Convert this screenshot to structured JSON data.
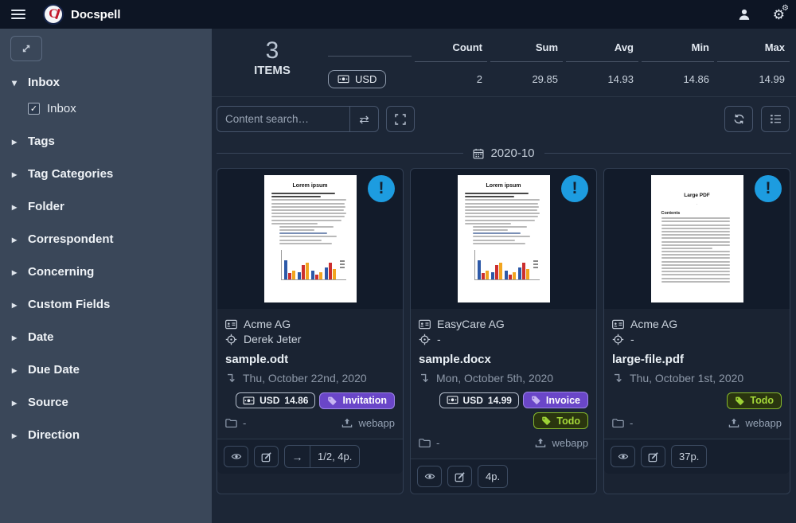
{
  "navbar": {
    "title": "Docspell"
  },
  "sidebar": {
    "inbox_header": "Inbox",
    "inbox_filter_label": "Inbox",
    "inbox_checked": true,
    "items": [
      "Tags",
      "Tag Categories",
      "Folder",
      "Correspondent",
      "Concerning",
      "Custom Fields",
      "Date",
      "Due Date",
      "Source",
      "Direction"
    ]
  },
  "stats": {
    "count_value": "3",
    "count_label": "ITEMS",
    "currency": "USD",
    "columns": [
      "Count",
      "Sum",
      "Avg",
      "Min",
      "Max"
    ],
    "values": [
      "2",
      "29.85",
      "14.93",
      "14.86",
      "14.99"
    ]
  },
  "toolbar": {
    "search_placeholder": "Content search…"
  },
  "group": {
    "label": "2020-10"
  },
  "cards": [
    {
      "correspondent": "Acme AG",
      "concerning": "Derek Jeter",
      "filename": "sample.odt",
      "date": "Thu, October 22nd, 2020",
      "money_currency": "USD",
      "money_amount": "14.86",
      "tags": [
        {
          "label": "Invitation",
          "color": "purple"
        }
      ],
      "folder": "-",
      "source": "webapp",
      "pages": "1/2, 4p.",
      "has_nav_arrow": true,
      "thumb": {
        "type": "office",
        "title": "Lorem ipsum"
      }
    },
    {
      "correspondent": "EasyCare AG",
      "concerning": "-",
      "filename": "sample.docx",
      "date": "Mon, October 5th, 2020",
      "money_currency": "USD",
      "money_amount": "14.99",
      "tags": [
        {
          "label": "Invoice",
          "color": "purple"
        },
        {
          "label": "Todo",
          "color": "green"
        }
      ],
      "folder": "-",
      "source": "webapp",
      "pages": "4p.",
      "has_nav_arrow": false,
      "thumb": {
        "type": "office",
        "title": "Lorem ipsum"
      }
    },
    {
      "correspondent": "Acme AG",
      "concerning": "-",
      "filename": "large-file.pdf",
      "date": "Thu, October 1st, 2020",
      "money_currency": null,
      "money_amount": null,
      "tags": [
        {
          "label": "Todo",
          "color": "green"
        }
      ],
      "folder": "-",
      "source": "webapp",
      "pages": "37p.",
      "has_nav_arrow": false,
      "thumb": {
        "type": "pdf",
        "title": "Large PDF",
        "heading": "Contents"
      }
    }
  ]
}
